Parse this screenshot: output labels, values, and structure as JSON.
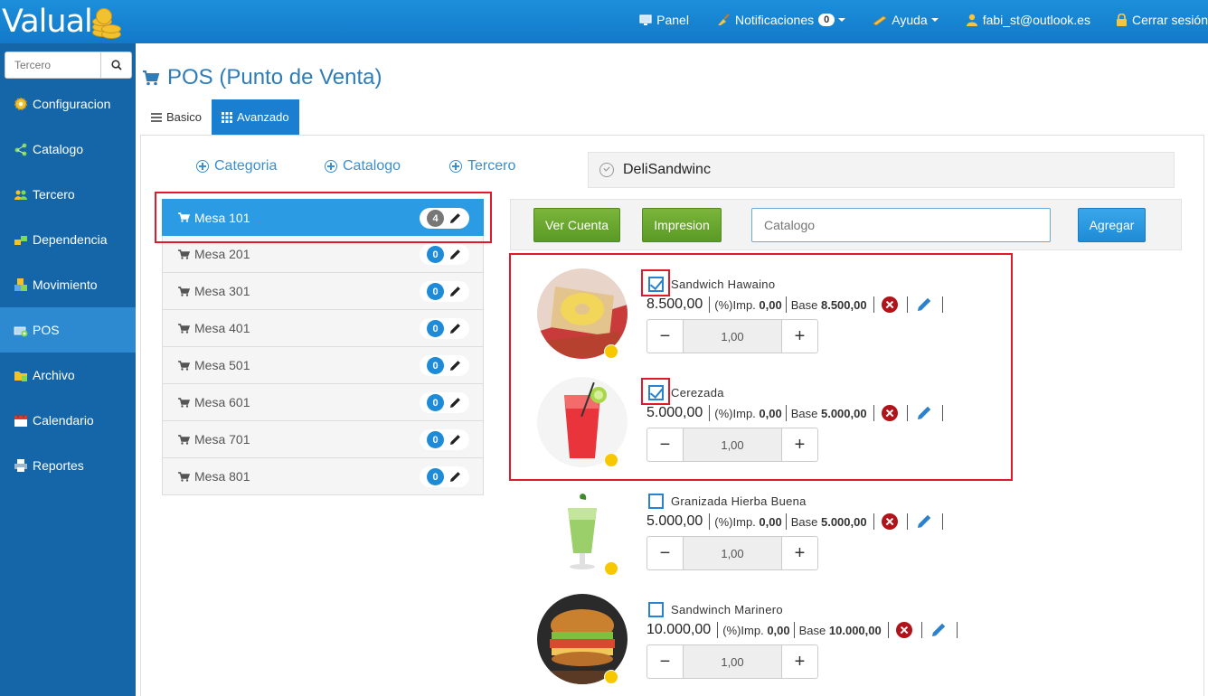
{
  "app": {
    "logo_text": "Valual"
  },
  "topnav": {
    "panel": "Panel",
    "notifications": "Notificaciones",
    "notifications_count": "0",
    "help": "Ayuda",
    "user": "fabi_st@outlook.es",
    "logout": "Cerrar sesión"
  },
  "sidebar": {
    "search_placeholder": "Tercero",
    "items": [
      {
        "label": "Configuracion",
        "icon": "gear-icon"
      },
      {
        "label": "Catalogo",
        "icon": "share-nodes-icon"
      },
      {
        "label": "Tercero",
        "icon": "users-icon"
      },
      {
        "label": "Dependencia",
        "icon": "blocks-icon"
      },
      {
        "label": "Movimiento",
        "icon": "boxes-icon"
      },
      {
        "label": "POS",
        "icon": "register-icon",
        "active": true
      },
      {
        "label": "Archivo",
        "icon": "folder-icon"
      },
      {
        "label": "Calendario",
        "icon": "calendar-icon"
      },
      {
        "label": "Reportes",
        "icon": "printer-icon"
      }
    ]
  },
  "page": {
    "title": "POS (Punto de Venta)",
    "tabs": [
      {
        "label": "Basico"
      },
      {
        "label": "Avanzado",
        "active": true
      }
    ]
  },
  "add_links": {
    "categoria": "Categoria",
    "catalogo": "Catalogo",
    "tercero": "Tercero"
  },
  "client": {
    "name": "DeliSandwinc"
  },
  "tables": [
    {
      "name": "Mesa 101",
      "count": "4",
      "active": true
    },
    {
      "name": "Mesa 201",
      "count": "0"
    },
    {
      "name": "Mesa 301",
      "count": "0"
    },
    {
      "name": "Mesa 401",
      "count": "0"
    },
    {
      "name": "Mesa 501",
      "count": "0"
    },
    {
      "name": "Mesa 601",
      "count": "0"
    },
    {
      "name": "Mesa 701",
      "count": "0"
    },
    {
      "name": "Mesa 801",
      "count": "0"
    }
  ],
  "toolbar": {
    "ver_cuenta": "Ver Cuenta",
    "impresion": "Impresion",
    "catalog_placeholder": "Catalogo",
    "agregar": "Agregar"
  },
  "products": [
    {
      "name": "Sandwich Hawaino",
      "price": "8.500,00",
      "tax_label": "(%)Imp.",
      "tax": "0,00",
      "base_label": "Base",
      "base": "8.500,00",
      "qty": "1,00",
      "checked": true
    },
    {
      "name": "Cerezada",
      "price": "5.000,00",
      "tax_label": "(%)Imp.",
      "tax": "0,00",
      "base_label": "Base",
      "base": "5.000,00",
      "qty": "1,00",
      "checked": true
    },
    {
      "name": "Granizada Hierba Buena",
      "price": "5.000,00",
      "tax_label": "(%)Imp.",
      "tax": "0,00",
      "base_label": "Base",
      "base": "5.000,00",
      "qty": "1,00",
      "checked": false
    },
    {
      "name": "Sandwinch Marinero",
      "price": "10.000,00",
      "tax_label": "(%)Imp.",
      "tax": "0,00",
      "base_label": "Base",
      "base": "10.000,00",
      "qty": "1,00",
      "checked": false
    }
  ],
  "colors": {
    "topbar": "#1a86d6",
    "sidebar": "#1466a8",
    "accent": "#2b9be4",
    "green_button": "#6aa830",
    "highlight_box": "#e0192b"
  }
}
